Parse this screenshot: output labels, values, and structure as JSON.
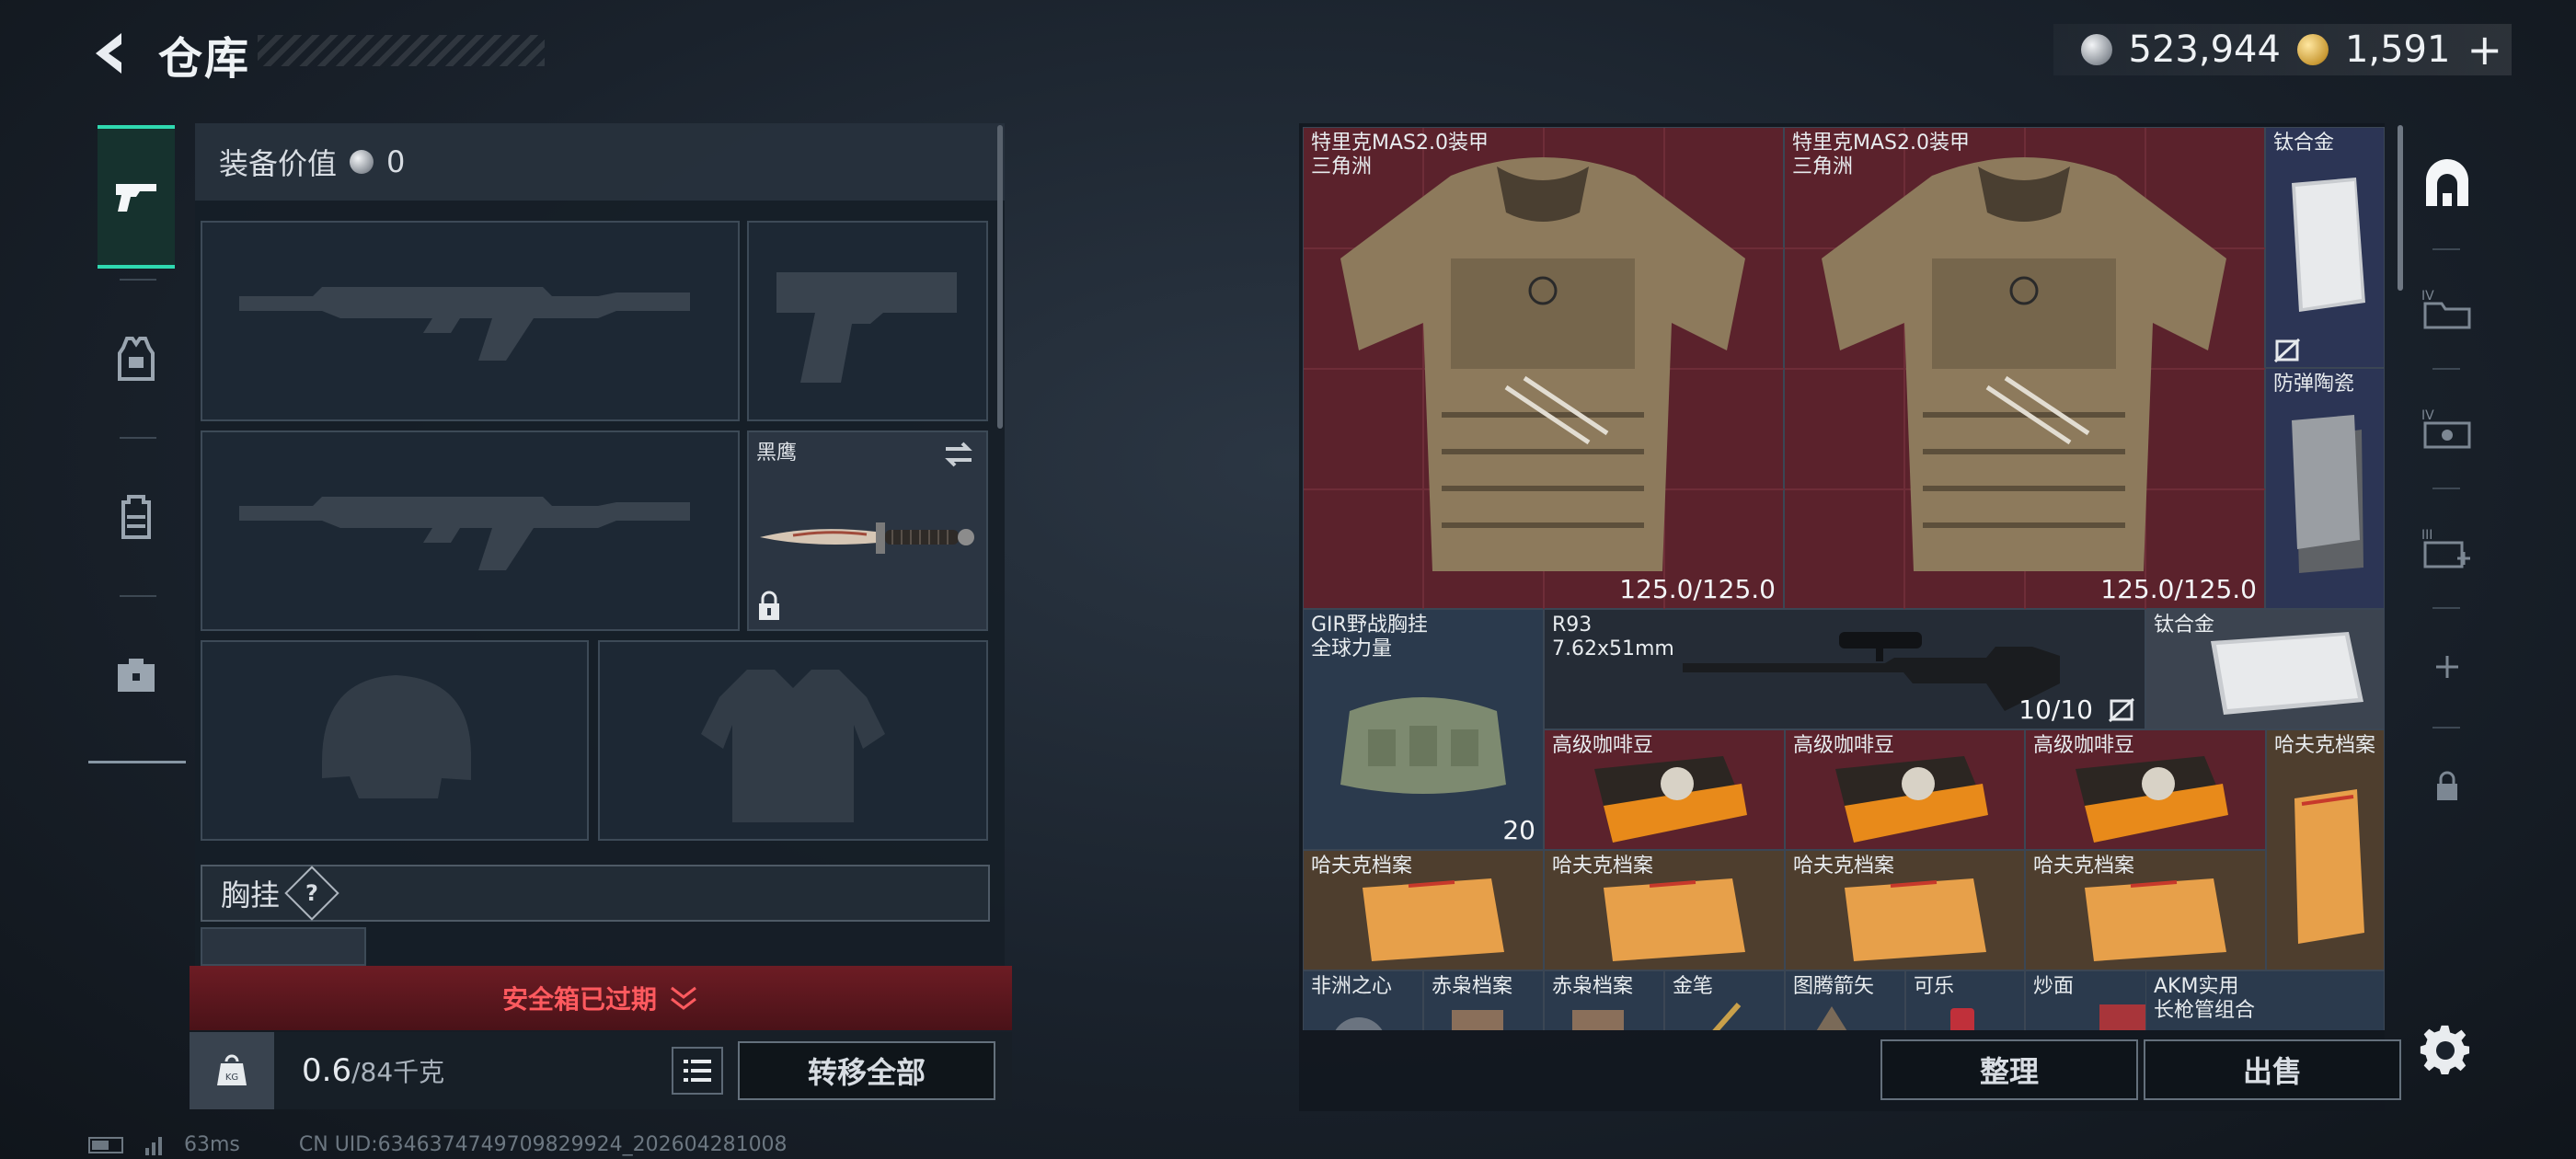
{
  "header": {
    "title": "仓库",
    "currency_silver": "523,944",
    "currency_gold": "1,591",
    "plus": "+"
  },
  "left_nav": {
    "items": [
      {
        "name": "weapons",
        "icon": "pistol-icon",
        "active": true
      },
      {
        "name": "armor",
        "icon": "vest-icon",
        "active": false
      },
      {
        "name": "backpack",
        "icon": "backpack-icon",
        "active": false
      },
      {
        "name": "briefcase",
        "icon": "briefcase-icon",
        "active": false
      }
    ]
  },
  "equipment": {
    "value_label": "装备价值",
    "value": "0",
    "melee_label": "黑鹰",
    "chest_label": "胸挂",
    "help": "?"
  },
  "safe_box": {
    "expired_text": "安全箱已过期"
  },
  "weight": {
    "current": "0.6",
    "max": "/84千克"
  },
  "buttons": {
    "transfer_all": "转移全部",
    "sort": "整理",
    "sell": "出售"
  },
  "status": {
    "ping": "63ms",
    "uid": "CN UID:6346374749709829924_202604281008"
  },
  "stash_items": [
    {
      "name": "特里克MAS2.0装甲\n三角洲",
      "durability": "125.0/125.0"
    },
    {
      "name": "特里克MAS2.0装甲\n三角洲",
      "durability": "125.0/125.0"
    },
    {
      "name": "钛合金"
    },
    {
      "name": "防弹陶瓷"
    },
    {
      "name": "GIR野战胸挂\n全球力量",
      "count": "20"
    },
    {
      "name": "R93\n7.62x51mm",
      "ammo": "10/10"
    },
    {
      "name": "钛合金"
    },
    {
      "name": "高级咖啡豆"
    },
    {
      "name": "高级咖啡豆"
    },
    {
      "name": "高级咖啡豆"
    },
    {
      "name": "哈夫克档案"
    },
    {
      "name": "哈夫克档案"
    },
    {
      "name": "哈夫克档案"
    },
    {
      "name": "哈夫克档案"
    },
    {
      "name": "哈夫克档案"
    },
    {
      "name": "非洲之心"
    },
    {
      "name": "赤枭档案"
    },
    {
      "name": "赤枭档案"
    },
    {
      "name": "金笔"
    },
    {
      "name": "图腾箭矢"
    },
    {
      "name": "可乐"
    },
    {
      "name": "炒面"
    },
    {
      "name": "AKM实用\n长枪管组合"
    }
  ],
  "colors": {
    "accent": "#2fd9b0",
    "danger": "#ff5a5f",
    "armor_bg": "#5b222c"
  }
}
